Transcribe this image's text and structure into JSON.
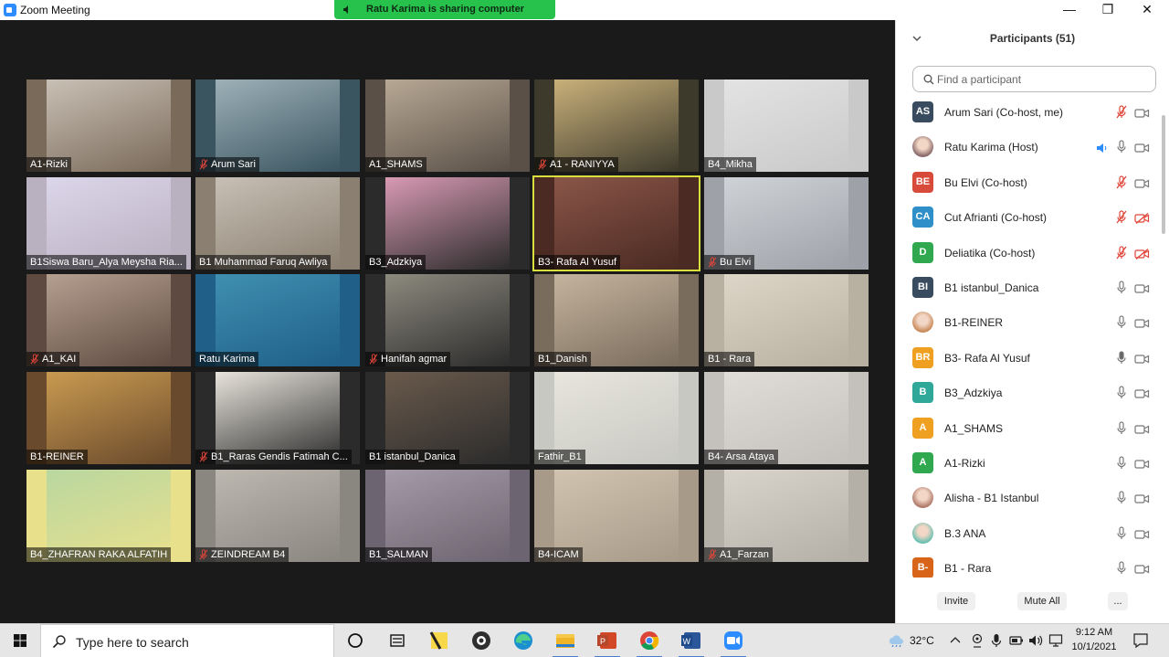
{
  "window": {
    "title": "Zoom Meeting",
    "share_banner": "Ratu Karima is sharing computer sound",
    "minimize": "—",
    "restore": "❐",
    "close": "✕"
  },
  "tiles": [
    {
      "label": "A1-Rizki",
      "muted": false,
      "bg": "#7a6a5a",
      "frame": "#c9c0b5"
    },
    {
      "label": "Arum Sari",
      "muted": true,
      "bg": "#3a5560",
      "frame": "#9db0b8"
    },
    {
      "label": "A1_SHAMS",
      "muted": false,
      "bg": "#5a5048",
      "frame": "#b7a894"
    },
    {
      "label": "A1 - RANIYYA",
      "muted": true,
      "bg": "#3d3a2c",
      "frame": "#c9b07a"
    },
    {
      "label": "B4_Mikha",
      "muted": false,
      "bg": "#c9c9c9",
      "frame": "#e3e3e3"
    },
    {
      "label": "B1Siswa Baru_Alya Meysha Ria...",
      "muted": false,
      "bg": "#b9b0c0",
      "frame": "#dcd6ea"
    },
    {
      "label": "B1 Muhammad Faruq Awliya",
      "muted": false,
      "bg": "#8a7f70",
      "frame": "#c7bfb5"
    },
    {
      "label": "B3_Adzkiya",
      "muted": false,
      "bg": "#2b2b2b",
      "frame": "#d89ab3"
    },
    {
      "label": "B3- Rafa Al Yusuf",
      "muted": false,
      "bg": "#4a2a22",
      "frame": "#8a5548"
    },
    {
      "label": "Bu Elvi",
      "muted": true,
      "bg": "#9ea2a8",
      "frame": "#cfd2d6"
    },
    {
      "label": "A1_KAI",
      "muted": true,
      "bg": "#5e4a40",
      "frame": "#b59f90"
    },
    {
      "label": "Ratu Karima",
      "muted": false,
      "bg": "#1f5f88",
      "frame": "#3f8fb0"
    },
    {
      "label": "Hanifah agmar",
      "muted": true,
      "bg": "#2c2c2c",
      "frame": "#8d8a7e"
    },
    {
      "label": "B1_Danish",
      "muted": false,
      "bg": "#7a6c5c",
      "frame": "#c4b49e"
    },
    {
      "label": "B1 - Rara",
      "muted": false,
      "bg": "#b8b0a0",
      "frame": "#ddd6c8"
    },
    {
      "label": "B1-REINER",
      "muted": false,
      "bg": "#6a4a2c",
      "frame": "#c99a50"
    },
    {
      "label": "B1_Raras Gendis Fatimah C...",
      "muted": true,
      "bg": "#2b2b2b",
      "frame": "#e8e4dc"
    },
    {
      "label": "B1 istanbul_Danica",
      "muted": false,
      "bg": "#2b2b2b",
      "frame": "#6a5a4c"
    },
    {
      "label": "Fathir_B1",
      "muted": false,
      "bg": "#c8c8c2",
      "frame": "#e7e5dc"
    },
    {
      "label": "B4- Arsa Ataya",
      "muted": false,
      "bg": "#c4c0bc",
      "frame": "#e0dcd8"
    },
    {
      "label": "B4_ZHAFRAN RAKA ALFATIH",
      "muted": false,
      "bg": "#e9e08c",
      "frame": "#b9d7a0"
    },
    {
      "label": "ZEINDREAM B4",
      "muted": true,
      "bg": "#8a8680",
      "frame": "#bcb8b0"
    },
    {
      "label": "B1_SALMAN",
      "muted": false,
      "bg": "#6c6470",
      "frame": "#a59aa8"
    },
    {
      "label": "B4-ICAM",
      "muted": false,
      "bg": "#a89a88",
      "frame": "#d0c4b0"
    },
    {
      "label": "A1_Farzan",
      "muted": true,
      "bg": "#b4b0a8",
      "frame": "#d8d4cc"
    }
  ],
  "panel": {
    "title": "Participants (51)",
    "search_placeholder": "Find a participant",
    "invite": "Invite",
    "mute_all": "Mute All",
    "more": "..."
  },
  "participants": [
    {
      "name": "Arum Sari (Co-host, me)",
      "initials": "AS",
      "color": "#394b5e",
      "mic": "muted",
      "video": "on",
      "photo": false
    },
    {
      "name": "Ratu Karima (Host)",
      "initials": "",
      "color": "#8a6a6a",
      "mic": "on",
      "video": "on",
      "photo": true,
      "sharing": true
    },
    {
      "name": "Bu Elvi (Co-host)",
      "initials": "BE",
      "color": "#d84a3a",
      "mic": "muted",
      "video": "on",
      "photo": false
    },
    {
      "name": "Cut Afrianti (Co-host)",
      "initials": "CA",
      "color": "#2f8fc9",
      "mic": "muted",
      "video": "off",
      "photo": false
    },
    {
      "name": "Deliatika (Co-host)",
      "initials": "D",
      "color": "#2fa84f",
      "mic": "muted",
      "video": "off",
      "photo": false
    },
    {
      "name": "B1 istanbul_Danica",
      "initials": "BI",
      "color": "#394b5e",
      "mic": "on",
      "video": "on",
      "photo": false
    },
    {
      "name": "B1-REINER",
      "initials": "",
      "color": "#c98a5a",
      "mic": "on",
      "video": "on",
      "photo": true
    },
    {
      "name": "B3- Rafa Al Yusuf",
      "initials": "BR",
      "color": "#f0a020",
      "mic": "active",
      "video": "on",
      "photo": false
    },
    {
      "name": "B3_Adzkiya",
      "initials": "B",
      "color": "#2fa89a",
      "mic": "on",
      "video": "on",
      "photo": false
    },
    {
      "name": "A1_SHAMS",
      "initials": "A",
      "color": "#f0a020",
      "mic": "on",
      "video": "on",
      "photo": false
    },
    {
      "name": "A1-Rizki",
      "initials": "A",
      "color": "#2fa84f",
      "mic": "on",
      "video": "on",
      "photo": false
    },
    {
      "name": "Alisha - B1 Istanbul",
      "initials": "",
      "color": "#b07a6a",
      "mic": "on",
      "video": "on",
      "photo": true
    },
    {
      "name": "B.3   ANA",
      "initials": "",
      "color": "#6ac0b0",
      "mic": "on",
      "video": "on",
      "photo": true
    },
    {
      "name": "B1 - Rara",
      "initials": "B-",
      "color": "#d8641a",
      "mic": "on",
      "video": "on",
      "photo": false
    }
  ],
  "taskbar": {
    "search_placeholder": "Type here to search",
    "apps": [
      "task-view-circle",
      "task-view",
      "sticky-notes",
      "obs",
      "edge",
      "file-explorer",
      "powerpoint",
      "chrome",
      "word",
      "zoom"
    ],
    "temperature": "32°C",
    "time": "9:12 AM",
    "date": "10/1/2021"
  }
}
